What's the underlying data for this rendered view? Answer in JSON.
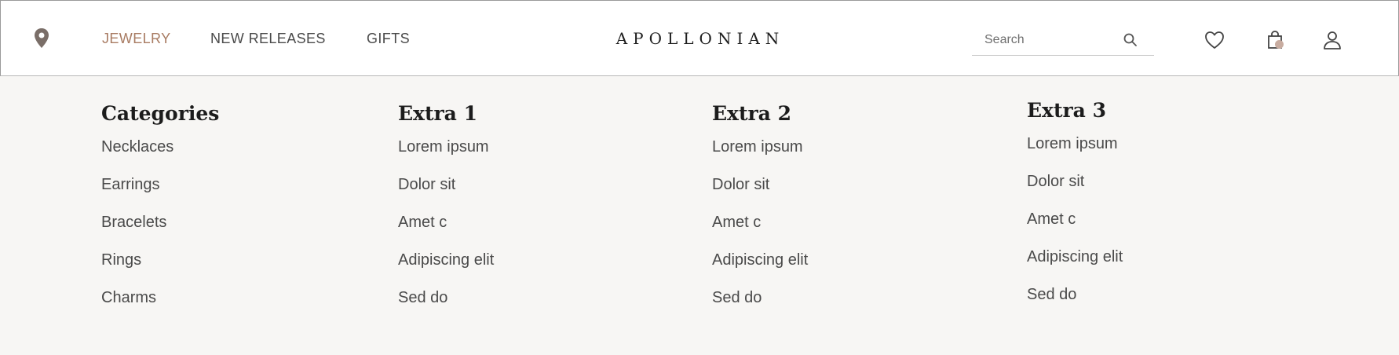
{
  "nav": {
    "location_icon": "map-pin-icon",
    "items": [
      {
        "label": "JEWELRY",
        "active": true
      },
      {
        "label": "NEW RELEASES",
        "active": false
      },
      {
        "label": "GIFTS",
        "active": false
      }
    ]
  },
  "brand": {
    "logo": "APOLLONIAN"
  },
  "search": {
    "placeholder": "Search",
    "value": "",
    "icon": "search-icon"
  },
  "actions": {
    "wishlist_icon": "heart-icon",
    "cart_icon": "shopping-bag-icon",
    "account_icon": "user-icon"
  },
  "colors": {
    "accent": "#a87b62",
    "badge": "#c8aca0",
    "menu_background": "#f7f6f4",
    "header_background": "#ffffff"
  },
  "menu": {
    "columns": [
      {
        "title": "Categories",
        "items": [
          "Necklaces",
          "Earrings",
          "Bracelets",
          "Rings",
          "Charms"
        ]
      },
      {
        "title": "Extra 1",
        "items": [
          "Lorem ipsum",
          "Dolor sit",
          "Amet c",
          "Adipiscing elit",
          "Sed do"
        ]
      },
      {
        "title": "Extra 2",
        "items": [
          "Lorem ipsum",
          "Dolor sit",
          "Amet c",
          "Adipiscing elit",
          "Sed do"
        ]
      },
      {
        "title": "Extra 3",
        "items": [
          "Lorem ipsum",
          "Dolor sit",
          "Amet c",
          "Adipiscing elit",
          "Sed do"
        ]
      }
    ]
  }
}
